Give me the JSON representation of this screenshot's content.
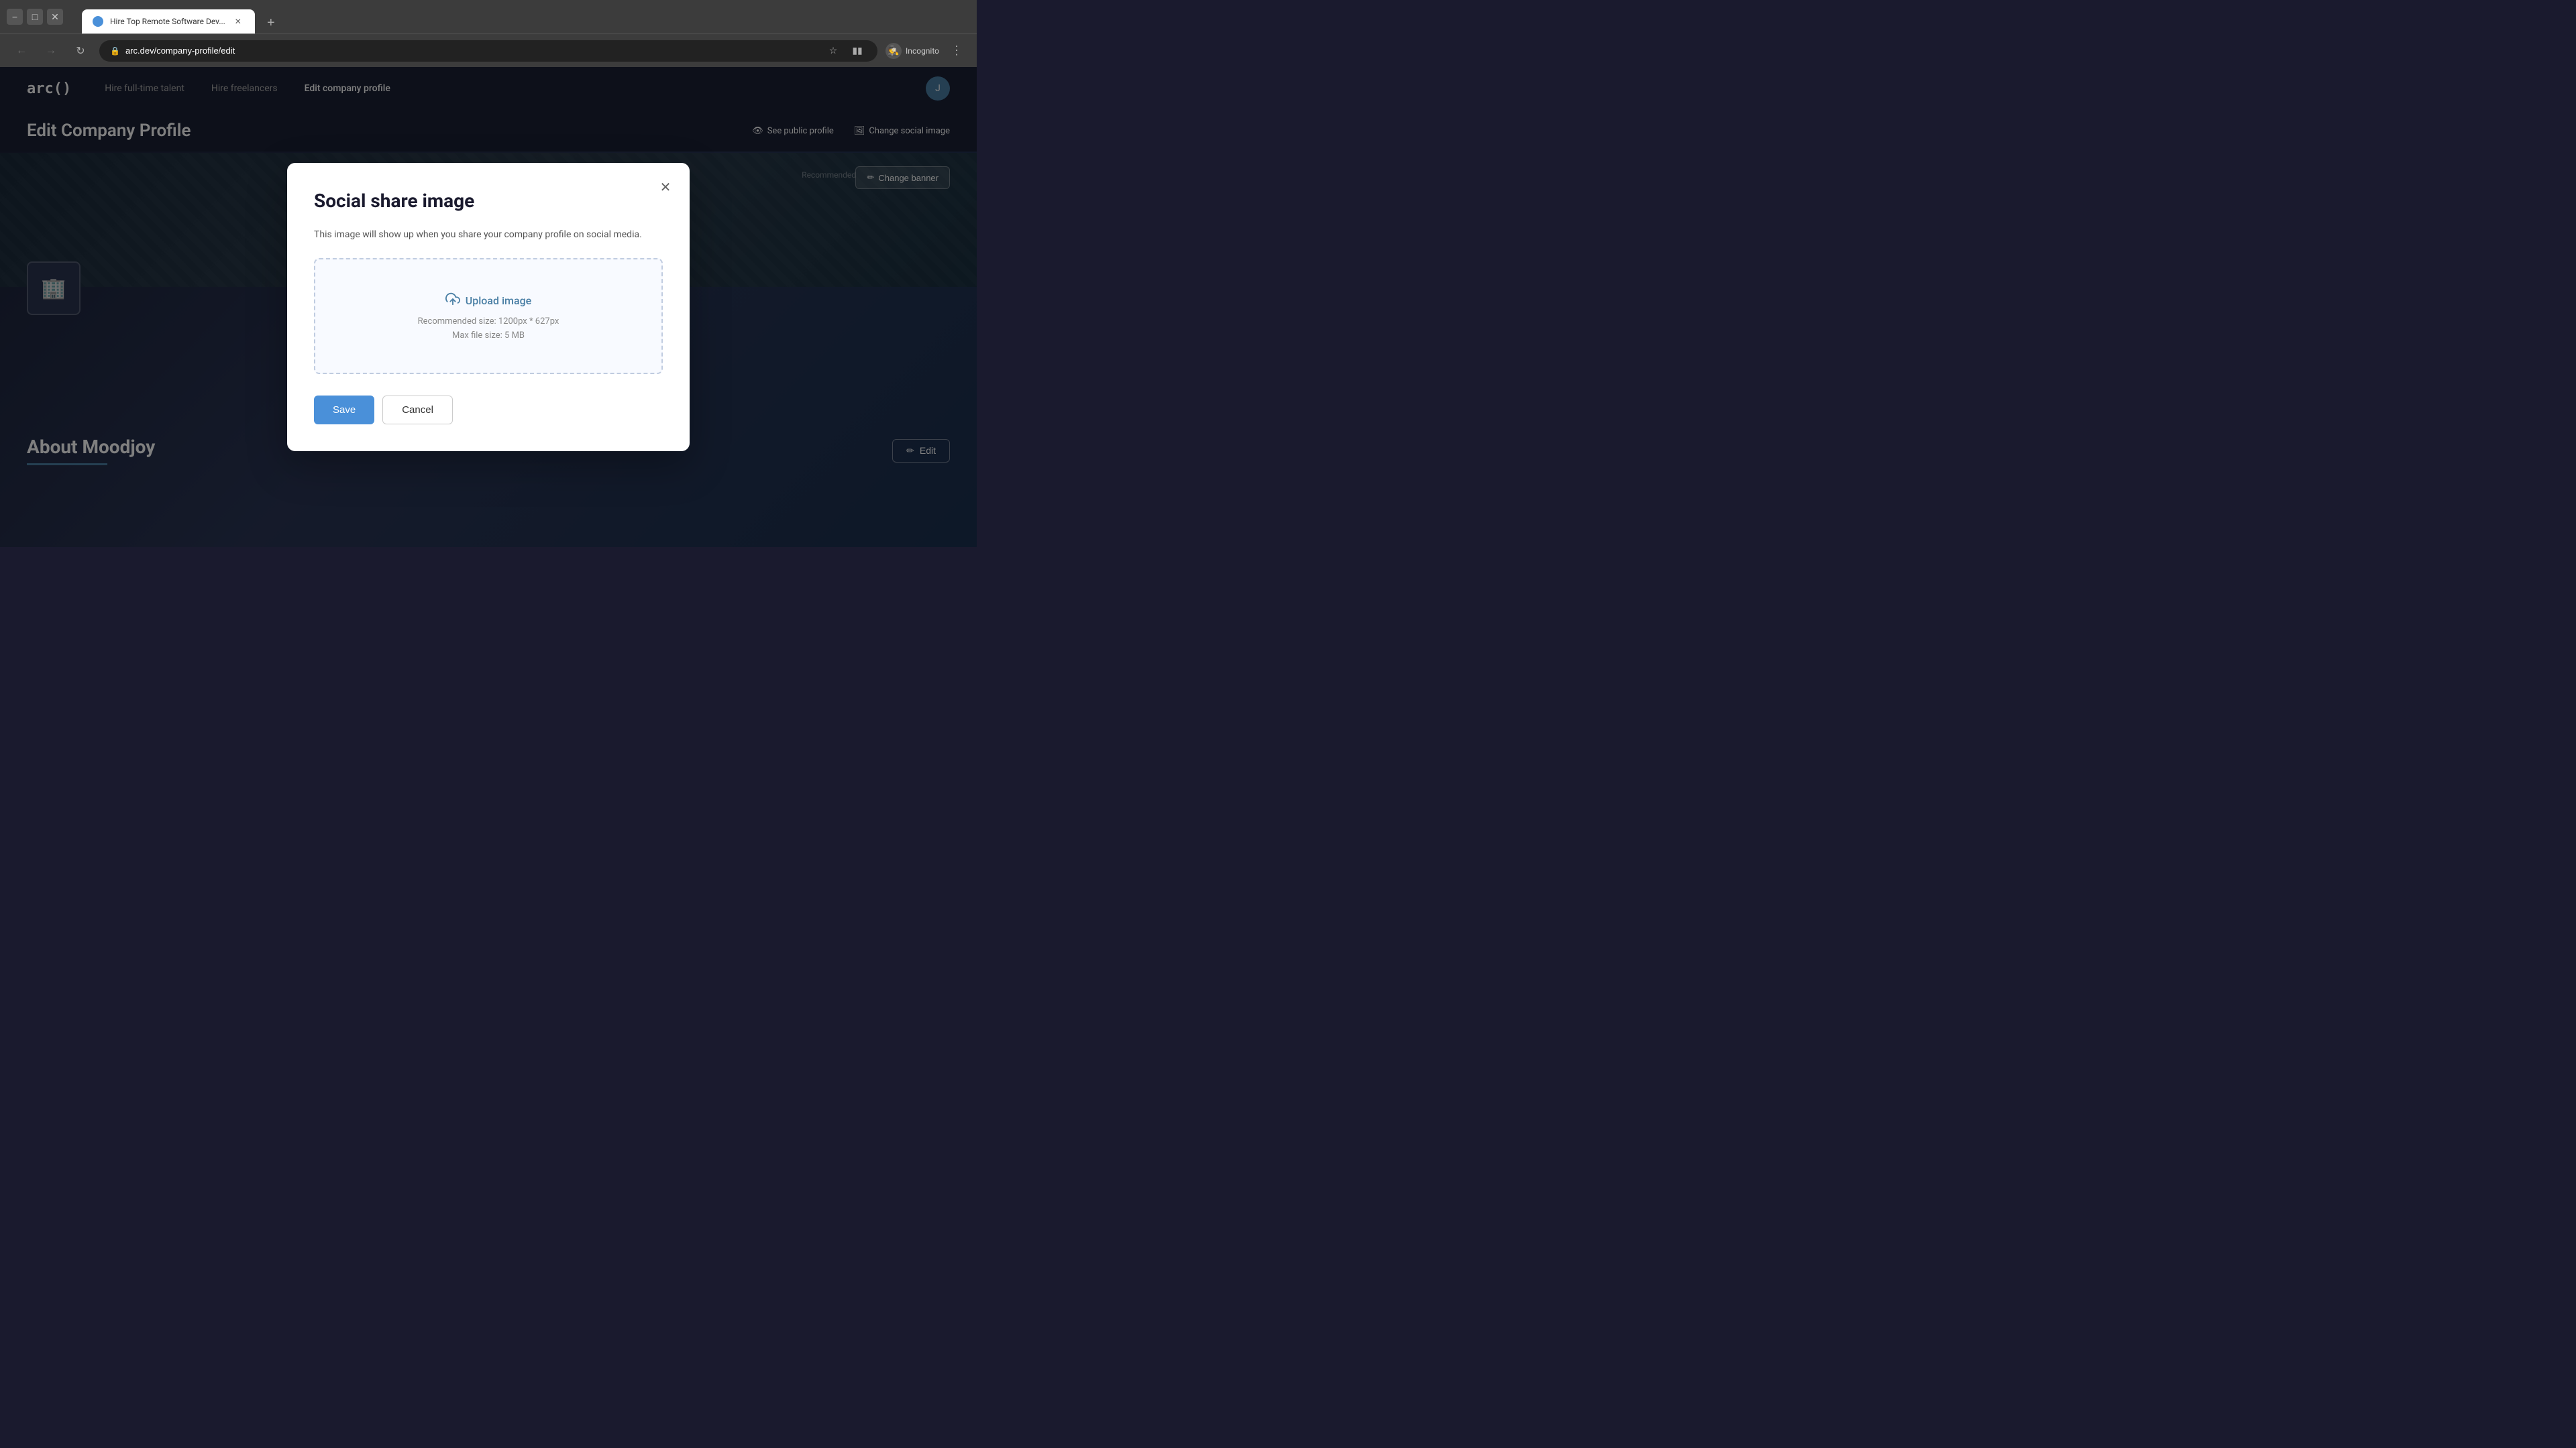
{
  "browser": {
    "tab": {
      "title": "Hire Top Remote Software Dev...",
      "favicon_color": "#4a90d9"
    },
    "address_bar": {
      "url": "arc.dev/company-profile/edit",
      "lock_icon": "🔒"
    },
    "incognito_label": "Incognito"
  },
  "navbar": {
    "logo": "arc()",
    "links": [
      {
        "label": "Hire full-time talent",
        "active": false
      },
      {
        "label": "Hire freelancers",
        "active": false
      },
      {
        "label": "Edit company profile",
        "active": true
      }
    ]
  },
  "edit_profile": {
    "title": "Edit Company Profile",
    "see_public_profile_label": "See public profile",
    "change_social_image_label": "Change social image",
    "change_banner_label": "Change banner",
    "recommended_text": "Recommended",
    "about_title": "About Moodjoy",
    "edit_label": "Edit"
  },
  "modal": {
    "title": "Social share image",
    "description": "This image will show up when you share your company profile on social media.",
    "upload_label": "Upload image",
    "recommended_size": "Recommended size: 1200px * 627px",
    "max_file_size": "Max file size: 5 MB",
    "save_label": "Save",
    "cancel_label": "Cancel"
  }
}
